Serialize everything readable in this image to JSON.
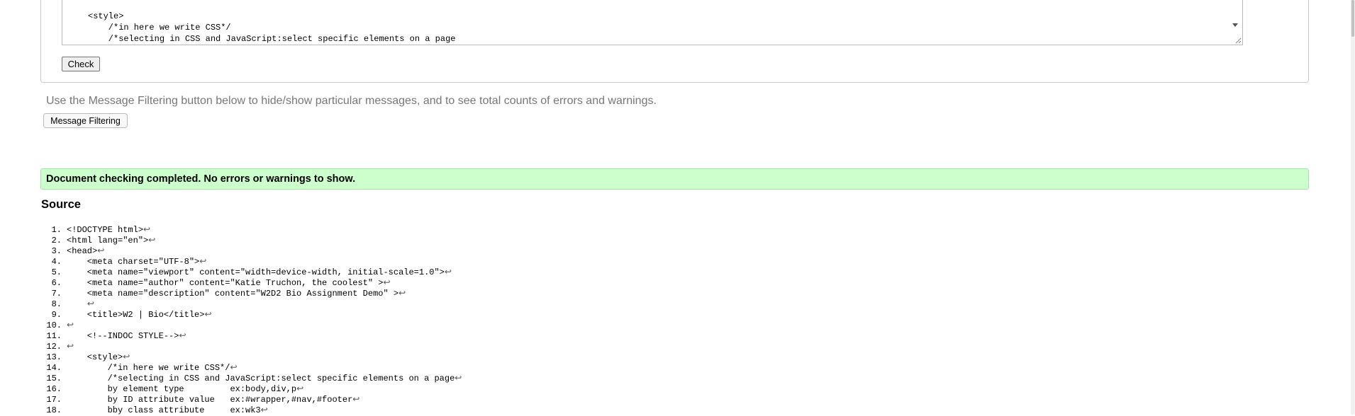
{
  "form": {
    "textarea_lines": [
      "<style>",
      "    /*in here we write CSS*/",
      "    /*selecting in CSS and JavaScript:select specific elements on a page"
    ],
    "check_label": "Check"
  },
  "filter_hint": "Use the Message Filtering button below to hide/show particular messages, and to see total counts of errors and warnings.",
  "filter_button_label": "Message Filtering",
  "result_message": "Document checking completed. No errors or warnings to show.",
  "source": {
    "title": "Source",
    "lines": [
      {
        "num": "1.",
        "code": "<!DOCTYPE html>"
      },
      {
        "num": "2.",
        "code": "<html lang=\"en\">"
      },
      {
        "num": "3.",
        "code": "<head>"
      },
      {
        "num": "4.",
        "code": "    <meta charset=\"UTF-8\">"
      },
      {
        "num": "5.",
        "code": "    <meta name=\"viewport\" content=\"width=device-width, initial-scale=1.0\">"
      },
      {
        "num": "6.",
        "code": "    <meta name=\"author\" content=\"Katie Truchon, the coolest\" >"
      },
      {
        "num": "7.",
        "code": "    <meta name=\"description\" content=\"W2D2 Bio Assignment Demo\" >"
      },
      {
        "num": "8.",
        "code": "    "
      },
      {
        "num": "9.",
        "code": "    <title>W2 | Bio</title>"
      },
      {
        "num": "10.",
        "code": ""
      },
      {
        "num": "11.",
        "code": "    <!--INDOC STYLE-->"
      },
      {
        "num": "12.",
        "code": ""
      },
      {
        "num": "13.",
        "code": "    <style>"
      },
      {
        "num": "14.",
        "code": "        /*in here we write CSS*/"
      },
      {
        "num": "15.",
        "code": "        /*selecting in CSS and JavaScript:select specific elements on a page"
      },
      {
        "num": "16.",
        "code": "        by element type         ex:body,div,p"
      },
      {
        "num": "17.",
        "code": "        by ID attribute value   ex:#wrapper,#nav,#footer"
      },
      {
        "num": "18.",
        "code": "        bby class attribute     ex:wk3"
      }
    ],
    "line_end_marker": "↩"
  }
}
